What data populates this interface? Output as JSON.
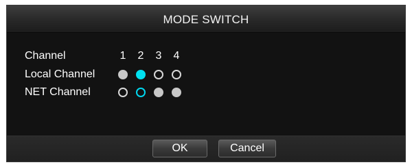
{
  "dialog": {
    "title": "MODE SWITCH",
    "header_label": "Channel",
    "channels": [
      "1",
      "2",
      "3",
      "4"
    ],
    "rows": [
      {
        "label": "Local Channel",
        "states": [
          "filled",
          "active-filled",
          "empty",
          "empty"
        ]
      },
      {
        "label": "NET Channel",
        "states": [
          "empty",
          "active-empty",
          "filled",
          "filled"
        ]
      }
    ],
    "ok_label": "OK",
    "cancel_label": "Cancel"
  },
  "colors": {
    "background": "#121212",
    "text": "#ffffff",
    "accent": "#00e0f0",
    "radio_filled": "#c8c8c8"
  }
}
